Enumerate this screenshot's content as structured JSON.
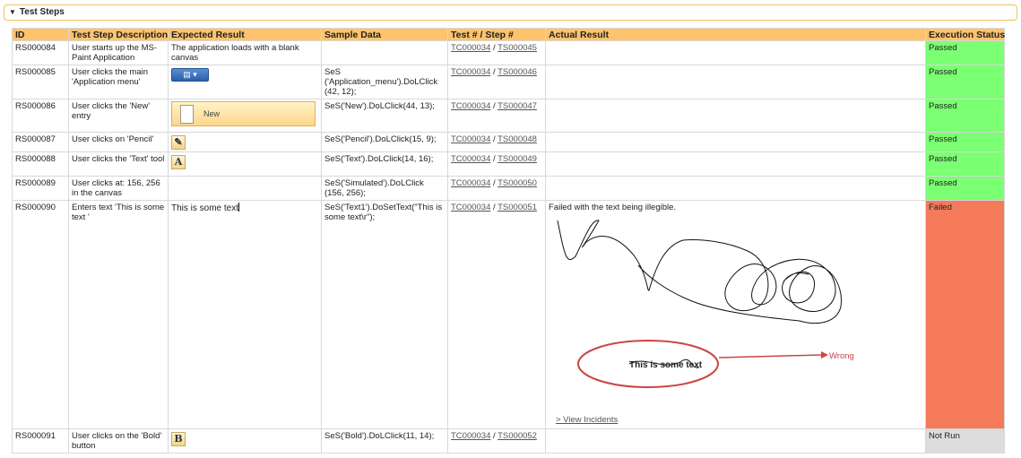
{
  "panel": {
    "title": "Test Steps",
    "toggle_glyph": "▼"
  },
  "columns": {
    "id": "ID",
    "description": "Test Step Description",
    "expected": "Expected Result",
    "sample": "Sample Data",
    "test_step": "Test # / Step #",
    "actual": "Actual Result",
    "status": "Execution Status"
  },
  "rows": [
    {
      "id": "RS000084",
      "description": "User starts up the MS-Paint Application",
      "expected_text": "The application loads with a blank canvas",
      "sample": "",
      "test": "TC000034",
      "step": "TS000045",
      "actual": "",
      "status": "Passed"
    },
    {
      "id": "RS000085",
      "description": "User clicks the main 'Application menu'",
      "expected_icon": "application-menu-icon",
      "expected_label": "▤ ▾",
      "sample": "SeS ('Application_menu').DoLClick (42, 12);",
      "test": "TC000034",
      "step": "TS000046",
      "actual": "",
      "status": "Passed"
    },
    {
      "id": "RS000086",
      "description": "User clicks the 'New' entry",
      "expected_icon": "new-document-icon",
      "expected_label": "New",
      "sample": "SeS('New').DoLClick(44, 13);",
      "test": "TC000034",
      "step": "TS000047",
      "actual": "",
      "status": "Passed"
    },
    {
      "id": "RS000087",
      "description": "User clicks on 'Pencil'",
      "expected_icon": "pencil-icon",
      "expected_label": "✎",
      "sample": "SeS('Pencil').DoLClick(15, 9);",
      "test": "TC000034",
      "step": "TS000048",
      "actual": "",
      "status": "Passed"
    },
    {
      "id": "RS000088",
      "description": "User clicks the 'Text' tool",
      "expected_icon": "text-tool-icon",
      "expected_label": "A",
      "sample": "SeS('Text').DoLClick(14, 16);",
      "test": "TC000034",
      "step": "TS000049",
      "actual": "",
      "status": "Passed"
    },
    {
      "id": "RS000089",
      "description": "User clicks at: 156, 256 in the canvas",
      "expected_text": "",
      "sample": "SeS('Simulated').DoLClick (156, 256);",
      "test": "TC000034",
      "step": "TS000050",
      "actual": "",
      "status": "Passed"
    },
    {
      "id": "RS000090",
      "description": "Enters text 'This is some text '",
      "expected_text": "This is some text",
      "sample": "SeS('Text1').DoSetText(\"This is some text\\r\");",
      "test": "TC000034",
      "step": "TS000051",
      "actual": "Failed with the text being illegible.",
      "actual_annotation": "Wrong",
      "actual_struck_text": "This is some text",
      "actual_link": "> View Incidents",
      "status": "Failed"
    },
    {
      "id": "RS000091",
      "description": "User clicks on the 'Bold' button",
      "expected_icon": "bold-icon",
      "expected_label": "B",
      "sample": "SeS('Bold').DoLClick(11, 14);",
      "test": "TC000034",
      "step": "TS000052",
      "actual": "",
      "status": "Not Run"
    }
  ],
  "colors": {
    "header": "#fdc36d",
    "passed": "#7bff73",
    "failed": "#f47a5a",
    "not_run": "#dcdcdc",
    "annotation": "#cc4444"
  }
}
